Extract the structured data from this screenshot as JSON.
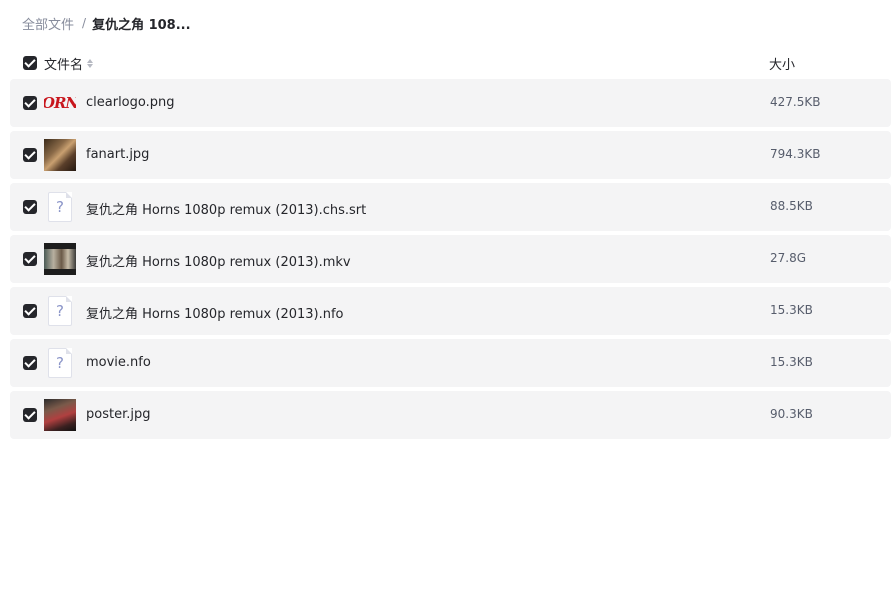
{
  "breadcrumb": {
    "root": "全部文件",
    "separator": "/",
    "current": "复仇之角 108..."
  },
  "table": {
    "header": {
      "name_label": "文件名",
      "size_label": "大小"
    },
    "rows": [
      {
        "name": "clearlogo.png",
        "size": "427.5KB",
        "thumb": "image",
        "logo_text": "ORN"
      },
      {
        "name": "fanart.jpg",
        "size": "794.3KB",
        "thumb": "image"
      },
      {
        "name": "复仇之角 Horns 1080p remux (2013).chs.srt",
        "size": "88.5KB",
        "thumb": "unknown-file-icon",
        "glyph": "?"
      },
      {
        "name": "复仇之角 Horns 1080p remux (2013).mkv",
        "size": "27.8G",
        "thumb": "video"
      },
      {
        "name": "复仇之角 Horns 1080p remux (2013).nfo",
        "size": "15.3KB",
        "thumb": "unknown-file-icon",
        "glyph": "?"
      },
      {
        "name": "movie.nfo",
        "size": "15.3KB",
        "thumb": "unknown-file-icon",
        "glyph": "?"
      },
      {
        "name": "poster.jpg",
        "size": "90.3KB",
        "thumb": "image"
      }
    ]
  },
  "colors": {
    "row_bg": "#f4f4f5",
    "checkbox": "#25262b",
    "muted_text": "#878c9c",
    "logo_red": "#c8161d"
  }
}
